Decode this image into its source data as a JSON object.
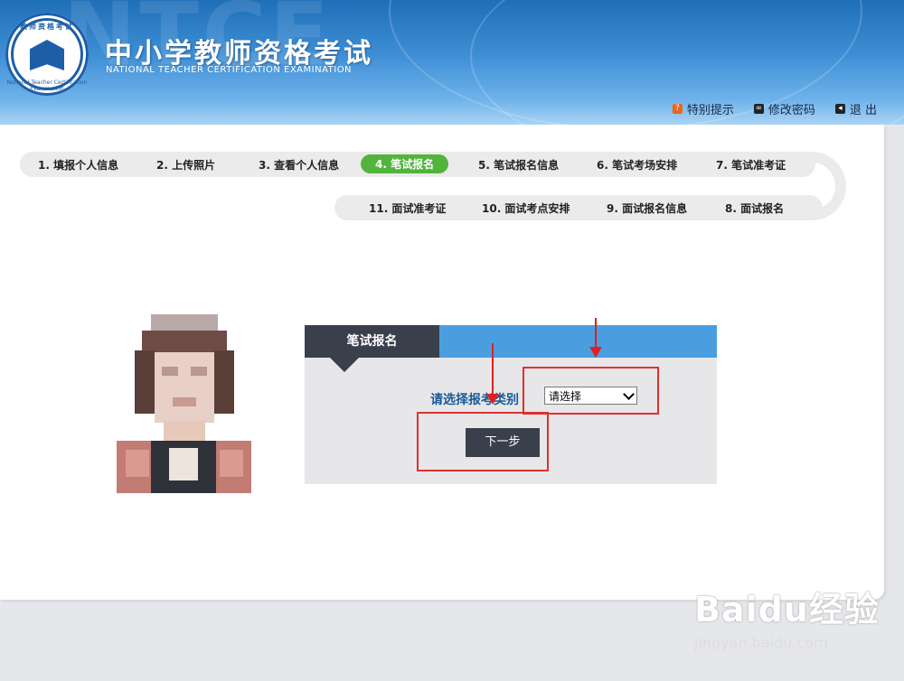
{
  "header": {
    "title": "中小学教师资格考试",
    "subtitle": "NATIONAL TEACHER CERTIFICATION EXAMINATION",
    "watermark": "NTCE",
    "logo_top_text": "教师资格考试",
    "logo_bottom_text": "National Teacher Certification Examination",
    "links": [
      {
        "label": "特别提示",
        "icon": "alert-icon"
      },
      {
        "label": "修改密码",
        "icon": "key-icon"
      },
      {
        "label": "退 出",
        "icon": "logout-icon"
      }
    ]
  },
  "steps_row1": [
    {
      "label": "1. 填报个人信息"
    },
    {
      "label": "2. 上传照片"
    },
    {
      "label": "3. 查看个人信息"
    },
    {
      "label": "4. 笔试报名",
      "active": true
    },
    {
      "label": "5. 笔试报名信息"
    },
    {
      "label": "6. 笔试考场安排"
    },
    {
      "label": "7. 笔试准考证"
    }
  ],
  "steps_row2": [
    {
      "label": "11. 面试准考证"
    },
    {
      "label": "10. 面试考点安排"
    },
    {
      "label": "9. 面试报名信息"
    },
    {
      "label": "8. 面试报名"
    }
  ],
  "form": {
    "tab_label": "笔试报名",
    "category_label": "请选择报考类别",
    "select_value": "请选择",
    "next_button": "下一步"
  },
  "watermark_brand": {
    "logo_text": "Baidu经验",
    "url": "jingyan.baidu.com"
  },
  "colors": {
    "header": "#3f8fd6",
    "active_step": "#52b43d",
    "dark_tab": "#3a3f4c",
    "tab_bar": "#4a9ee0",
    "label_blue": "#1a5b98",
    "annotation_red": "#e03030"
  }
}
